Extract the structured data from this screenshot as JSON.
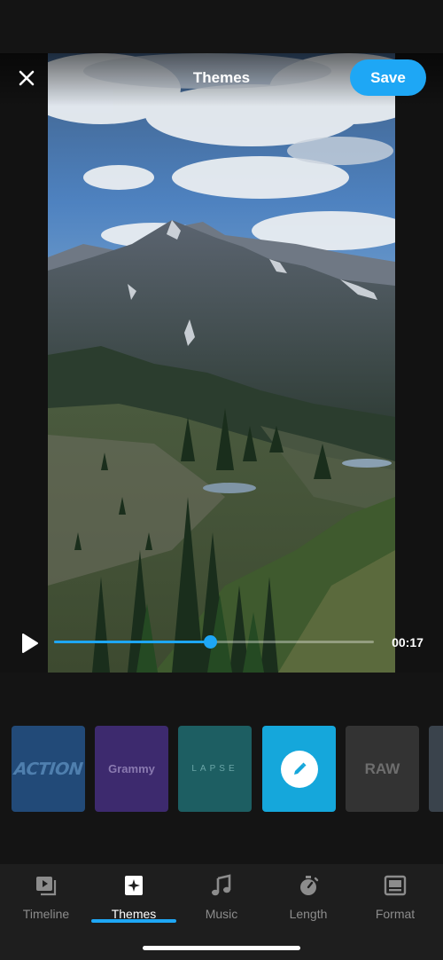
{
  "header": {
    "title": "Themes",
    "save_label": "Save",
    "close_icon": "close-icon"
  },
  "player": {
    "time": "00:17",
    "progress_fraction": 0.488
  },
  "themes": [
    {
      "id": "action",
      "label": "ACTION",
      "color": "#224a78"
    },
    {
      "id": "grammy",
      "label": "Grammy",
      "color": "#3d2a6e"
    },
    {
      "id": "lapse",
      "label": "LAPSE",
      "color": "#1d5e62"
    },
    {
      "id": "custom",
      "label": "",
      "icon": "pencil-icon",
      "color": "#15a7db",
      "selected": true
    },
    {
      "id": "raw",
      "label": "RAW",
      "color": "#333333"
    }
  ],
  "tabs": [
    {
      "id": "timeline",
      "label": "Timeline",
      "icon": "timeline-icon"
    },
    {
      "id": "themes",
      "label": "Themes",
      "icon": "sparkle-icon",
      "active": true
    },
    {
      "id": "music",
      "label": "Music",
      "icon": "music-note-icon"
    },
    {
      "id": "length",
      "label": "Length",
      "icon": "stopwatch-icon"
    },
    {
      "id": "format",
      "label": "Format",
      "icon": "format-icon"
    }
  ],
  "colors": {
    "accent": "#1ea7f5",
    "background": "#141414",
    "tabbar": "#1e1e1e"
  }
}
